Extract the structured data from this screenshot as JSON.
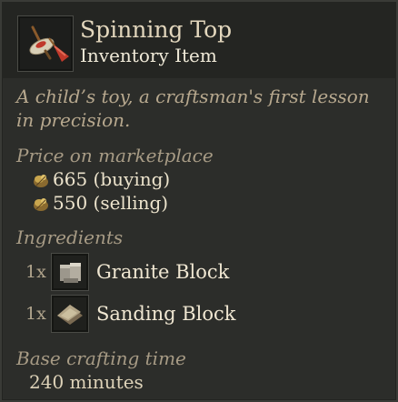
{
  "item": {
    "name": "Spinning Top",
    "type": "Inventory Item",
    "icon": "spinning-top-icon",
    "description": "A child’s toy, a craftsman's first lesson in precision."
  },
  "price": {
    "label": "Price on marketplace",
    "buying": "665 (buying)",
    "selling": "550 (selling)",
    "coin_icon": "coin-pouch-icon"
  },
  "ingredients": {
    "label": "Ingredients",
    "items": [
      {
        "qty": "1x",
        "name": "Granite Block",
        "icon": "granite-block-icon"
      },
      {
        "qty": "1x",
        "name": "Sanding Block",
        "icon": "sanding-block-icon"
      }
    ]
  },
  "crafting": {
    "label": "Base crafting time",
    "time": "240 minutes"
  },
  "colors": {
    "background": "#2c2d2a",
    "header": "#242522",
    "title": "#e3d7bd",
    "description": "#b7a88e",
    "label": "#a79b85",
    "accent_red": "#c0392b"
  }
}
